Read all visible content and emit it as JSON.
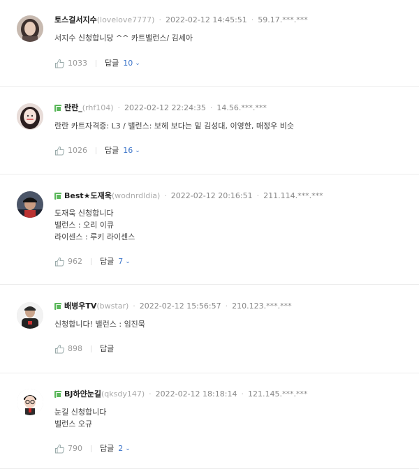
{
  "comments": [
    {
      "nick": "토스걸서지수",
      "uid": "(lovelove7777)",
      "date": "2022-02-12 14:45:51",
      "ip": "59.17.***.***",
      "lines": [
        "서지수 신청합니당 ^^ 카트밸런스/ 김세아"
      ],
      "likes": "1033",
      "reply_label": "답글",
      "reply_count": "10",
      "badge": false,
      "avatar_color": "#6b5b55"
    },
    {
      "nick": "란란_",
      "uid": "(rhf104)",
      "date": "2022-02-12 22:24:35",
      "ip": "14.56.***.***",
      "lines": [
        "란란 카트자격증: L3 / 밸런스:  보헤 보다는 밑 김성대, 이영한, 매정우 비슷"
      ],
      "likes": "1026",
      "reply_label": "답글",
      "reply_count": "16",
      "badge": true,
      "avatar_color": "#3a2a2a"
    },
    {
      "nick": "Best★도재욱",
      "uid": "(wodnrdldia)",
      "date": "2022-02-12 20:16:51",
      "ip": "211.114.***.***",
      "lines": [
        "도재욱 신청합니다",
        "밸런스 : 오리 이큐",
        "라이센스 : 루키 라이센스"
      ],
      "likes": "962",
      "reply_label": "답글",
      "reply_count": "7",
      "badge": true,
      "avatar_color": "#2c2f3a"
    },
    {
      "nick": "배병우TV",
      "uid": "(bwstar)",
      "date": "2022-02-12 15:56:57",
      "ip": "210.123.***.***",
      "lines": [
        "신청합니다! 밸런스 : 임진묵"
      ],
      "likes": "898",
      "reply_label": "답글",
      "reply_count": "",
      "badge": true,
      "avatar_color": "#4a4a4a"
    },
    {
      "nick": "BJ하얀눈길",
      "uid": "(qksdy147)",
      "date": "2022-02-12 18:18:14",
      "ip": "121.145.***.***",
      "lines": [
        "눈길 신청합니다",
        "벨런스 오규"
      ],
      "likes": "790",
      "reply_label": "답글",
      "reply_count": "2",
      "badge": true,
      "avatar_color": "#ffffff"
    }
  ],
  "colors": {
    "badge": "#5cb85c",
    "reply_count": "#3b74c9",
    "divider": "#ececec"
  },
  "icons": {
    "like": "thumbs-up-icon",
    "expand": "chevron-down-icon",
    "badge": "level-badge-icon"
  }
}
